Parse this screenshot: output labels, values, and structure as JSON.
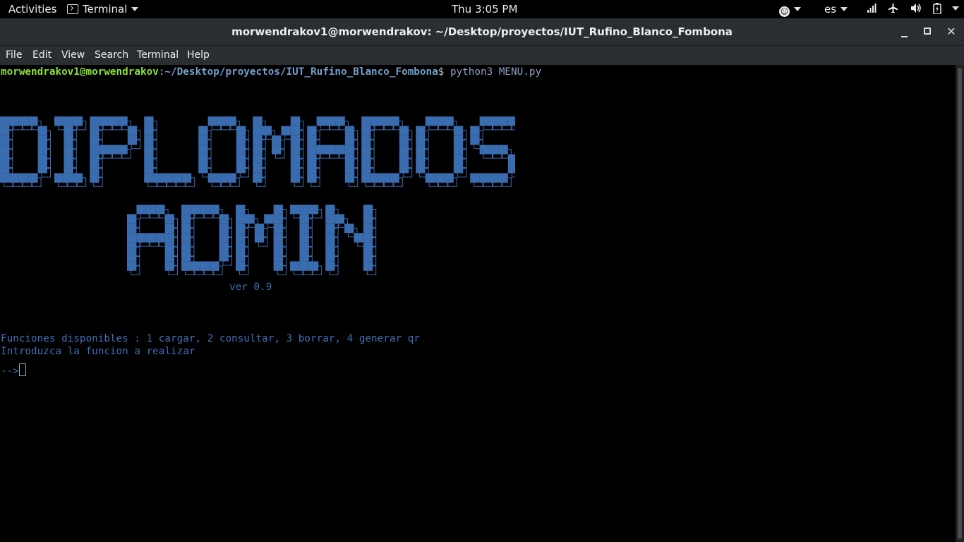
{
  "topbar": {
    "activities": "Activities",
    "app_name": "Terminal",
    "clock": "Thu  3:05 PM",
    "language": "es"
  },
  "window": {
    "title": "morwendrakov1@morwendrakov: ~/Desktop/proyectos/IUT_Rufino_Blanco_Fombona",
    "minimize_label": "minimize",
    "maximize_label": "maximize",
    "close_label": "✕"
  },
  "menubar": {
    "items": [
      "File",
      "Edit",
      "View",
      "Search",
      "Terminal",
      "Help"
    ]
  },
  "terminal": {
    "prompt_user": "morwendrakov1@morwendrakov",
    "prompt_sep": ":",
    "prompt_path": "~/Desktop/proyectos/IUT_Rufino_Blanco_Fombona",
    "prompt_symbol": "$ ",
    "command": "python3 MENU.py",
    "banner_line1": "DIPLOMADOS",
    "banner_line2": "ADMIN",
    "version": "ver 0.9",
    "functions_line": "Funciones disponibles : 1 cargar, 2 consultar, 3 borrar, 4 generar qr",
    "instruction_line": "Introduzca la funcion a realizar",
    "input_prompt": "-->"
  },
  "colors": {
    "banner_blue": "#3a6cb0",
    "text_blue": "#3d6fb3",
    "prompt_green": "#8ae234",
    "prompt_path_blue": "#729fcf"
  },
  "icons": [
    "terminal-icon",
    "accessibility-icon",
    "network-icon",
    "airplane-icon",
    "volume-icon",
    "battery-icon",
    "power-icon"
  ]
}
